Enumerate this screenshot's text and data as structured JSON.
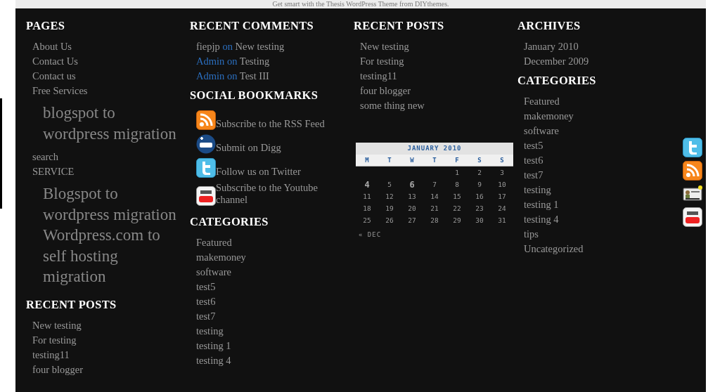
{
  "top_bar": {
    "text": "Get smart with the Thesis WordPress Theme from DIYthemes."
  },
  "columns": [
    [
      {
        "kind": "links",
        "title": "PAGES",
        "items": [
          {
            "label": "About Us"
          },
          {
            "label": "Contact Us"
          },
          {
            "label": "Contact us"
          },
          {
            "label": "Free Services",
            "children": [
              {
                "label": "blogspot to wordpress migration"
              }
            ]
          },
          {
            "label": "search"
          },
          {
            "label": "SERVICE",
            "children": [
              {
                "label": "Blogspot to wordpress migration"
              },
              {
                "label": "Wordpress.com to self hosting migration"
              }
            ]
          }
        ]
      },
      {
        "kind": "links",
        "title": "RECENT POSTS",
        "items": [
          {
            "label": "New testing"
          },
          {
            "label": "For testing"
          },
          {
            "label": "testing11"
          },
          {
            "label": "four blogger"
          }
        ]
      }
    ],
    [
      {
        "kind": "comments",
        "title": "RECENT COMMENTS",
        "items": [
          {
            "author": "fiepjp",
            "linked": false,
            "connector": "on",
            "post": "New testing"
          },
          {
            "author": "Admin",
            "linked": true,
            "connector": "on",
            "post": "Testing"
          },
          {
            "author": "Admin",
            "linked": true,
            "connector": "on",
            "post": "Test III"
          }
        ]
      },
      {
        "kind": "bookmarks",
        "title": "SOCIAL BOOKMARKS",
        "items": [
          {
            "label": "Subscribe to the RSS Feed"
          },
          {
            "label": "Submit on Digg"
          },
          {
            "label": "Follow us on Twitter"
          },
          {
            "label": "Subscribe to the Youtube channel"
          }
        ]
      },
      {
        "kind": "links",
        "title": "CATEGORIES",
        "items": [
          {
            "label": "Featured"
          },
          {
            "label": "makemoney"
          },
          {
            "label": "software"
          },
          {
            "label": "test5"
          },
          {
            "label": "test6"
          },
          {
            "label": "test7"
          },
          {
            "label": "testing"
          },
          {
            "label": "testing 1"
          },
          {
            "label": "testing 4"
          }
        ]
      }
    ],
    [
      {
        "kind": "links",
        "title": "RECENT POSTS",
        "items": [
          {
            "label": "New testing"
          },
          {
            "label": "For testing"
          },
          {
            "label": "testing11"
          },
          {
            "label": "four blogger"
          },
          {
            "label": "some thing new"
          }
        ]
      },
      {
        "kind": "calendar",
        "title": "JANUARY 2010",
        "weekdays": [
          "M",
          "T",
          "W",
          "T",
          "F",
          "S",
          "S"
        ],
        "weeks": [
          [
            {
              "day": "1",
              "posts": false
            },
            {
              "day": "2",
              "posts": false
            },
            {
              "day": "3",
              "posts": false
            }
          ],
          [
            {
              "day": "4",
              "posts": true
            },
            {
              "day": "5",
              "posts": false
            },
            {
              "day": "6",
              "posts": true
            },
            {
              "day": "7",
              "posts": false
            },
            {
              "day": "8",
              "posts": false
            },
            {
              "day": "9",
              "posts": false
            },
            {
              "day": "10",
              "posts": false
            }
          ],
          [
            {
              "day": "11",
              "posts": false
            },
            {
              "day": "12",
              "posts": false
            },
            {
              "day": "13",
              "posts": false
            },
            {
              "day": "14",
              "posts": false
            },
            {
              "day": "15",
              "posts": false
            },
            {
              "day": "16",
              "posts": false
            },
            {
              "day": "17",
              "posts": false
            }
          ],
          [
            {
              "day": "18",
              "posts": false
            },
            {
              "day": "19",
              "posts": false
            },
            {
              "day": "20",
              "posts": false
            },
            {
              "day": "21",
              "posts": false
            },
            {
              "day": "22",
              "posts": false
            },
            {
              "day": "23",
              "posts": false
            },
            {
              "day": "24",
              "posts": false
            }
          ],
          [
            {
              "day": "25",
              "posts": false
            },
            {
              "day": "26",
              "posts": false
            },
            {
              "day": "27",
              "posts": false
            },
            {
              "day": "28",
              "posts": false
            },
            {
              "day": "29",
              "posts": false
            },
            {
              "day": "30",
              "posts": false
            },
            {
              "day": "31",
              "posts": false
            }
          ]
        ],
        "prev": "« DEC"
      }
    ],
    [
      {
        "kind": "links",
        "title": "ARCHIVES",
        "items": [
          {
            "label": "January 2010"
          },
          {
            "label": "December 2009"
          }
        ]
      },
      {
        "kind": "links",
        "title": "CATEGORIES",
        "items": [
          {
            "label": "Featured"
          },
          {
            "label": "makemoney"
          },
          {
            "label": "software"
          },
          {
            "label": "test5"
          },
          {
            "label": "test6"
          },
          {
            "label": "test7"
          },
          {
            "label": "testing"
          },
          {
            "label": "testing 1"
          },
          {
            "label": "testing 4"
          },
          {
            "label": "tips"
          },
          {
            "label": "Uncategorized"
          }
        ]
      }
    ]
  ]
}
